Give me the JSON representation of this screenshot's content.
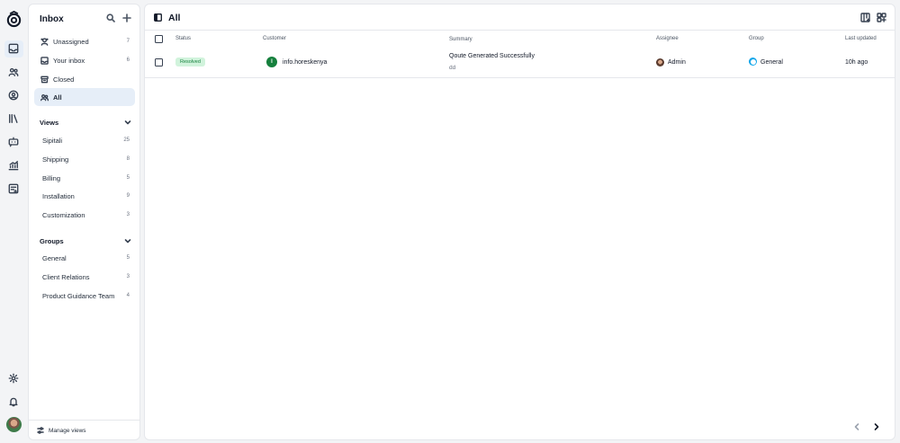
{
  "rail": {
    "icons": [
      "logo-icon",
      "inbox-icon",
      "contacts-icon",
      "profile-icon",
      "library-icon",
      "chatbot-icon",
      "analytics-icon",
      "notes-icon",
      "settings-icon",
      "bell-icon"
    ]
  },
  "sidebar": {
    "title": "Inbox",
    "nav": [
      {
        "label": "Unassigned",
        "count": "7",
        "icon": "unassigned-icon"
      },
      {
        "label": "Your inbox",
        "count": "6",
        "icon": "inbox-icon"
      },
      {
        "label": "Closed",
        "count": "",
        "icon": "archive-icon"
      },
      {
        "label": "All",
        "count": "",
        "icon": "users-icon",
        "active": true
      }
    ],
    "views_label": "Views",
    "views": [
      {
        "label": "Sipitali",
        "count": "25"
      },
      {
        "label": "Shipping",
        "count": "8"
      },
      {
        "label": "Billing",
        "count": "5"
      },
      {
        "label": "Installation",
        "count": "9"
      },
      {
        "label": "Customization",
        "count": "3"
      }
    ],
    "groups_label": "Groups",
    "groups": [
      {
        "label": "General",
        "count": "5"
      },
      {
        "label": "Client Relations",
        "count": "3"
      },
      {
        "label": "Product Guidance Team",
        "count": "4"
      }
    ],
    "footer_label": "Manage views"
  },
  "main": {
    "title": "All",
    "columns": {
      "status": "Status",
      "customer": "Customer",
      "summary": "Summary",
      "assignee": "Assignee",
      "group": "Group",
      "updated": "Last updated"
    },
    "rows": [
      {
        "status": "Resolved",
        "customer_initial": "I",
        "customer": "info.horeskenya",
        "summary_title": "Qoute Generated Successfully",
        "summary_sub": "dd",
        "assignee": "Admin",
        "group": "General",
        "updated": "10h ago"
      }
    ]
  },
  "colors": {
    "accent_bg": "#e6eef8",
    "resolved_bg": "#d1f3dc",
    "resolved_fg": "#15803d",
    "customer_avatar": "#15803d",
    "group_icon": "#0ea5e9"
  }
}
